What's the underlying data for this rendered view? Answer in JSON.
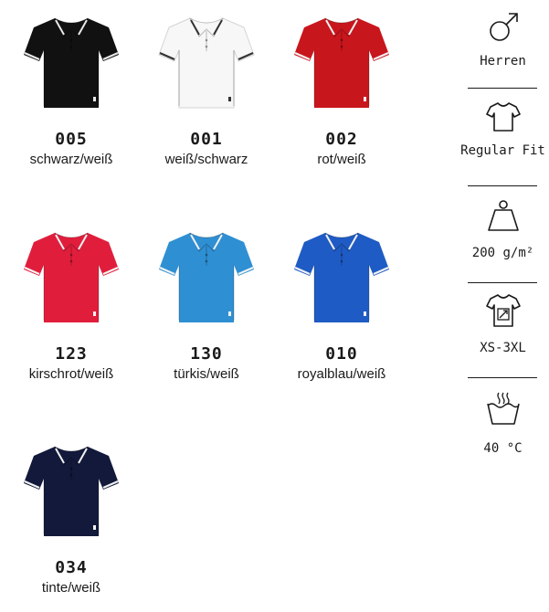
{
  "colors": [
    {
      "code": "005",
      "name": "schwarz/weiß",
      "body": "#111111",
      "tipping": "#e8e8e8"
    },
    {
      "code": "001",
      "name": "weiß/schwarz",
      "body": "#f7f7f7",
      "tipping": "#333333"
    },
    {
      "code": "002",
      "name": "rot/weiß",
      "body": "#c8161d",
      "tipping": "#f2f2f2"
    },
    {
      "code": "123",
      "name": "kirschrot/weiß",
      "body": "#e01e3c",
      "tipping": "#f2f2f2"
    },
    {
      "code": "130",
      "name": "türkis/weiß",
      "body": "#2f8fd3",
      "tipping": "#f2f2f2"
    },
    {
      "code": "010",
      "name": "royalblau/weiß",
      "body": "#1f5bc4",
      "tipping": "#f2f2f2"
    },
    {
      "code": "034",
      "name": "tinte/weiß",
      "body": "#12193a",
      "tipping": "#f2f2f2"
    }
  ],
  "specs": {
    "gender": {
      "label": "Herren",
      "icon": "male-icon"
    },
    "fit": {
      "label": "Regular Fit",
      "icon": "tshirt-icon"
    },
    "weight": {
      "label": "200 g/m²",
      "icon": "weight-icon"
    },
    "sizes": {
      "label": "XS-3XL",
      "icon": "size-range-icon"
    },
    "wash": {
      "label": "40 °C",
      "icon": "wash-40-icon"
    }
  }
}
